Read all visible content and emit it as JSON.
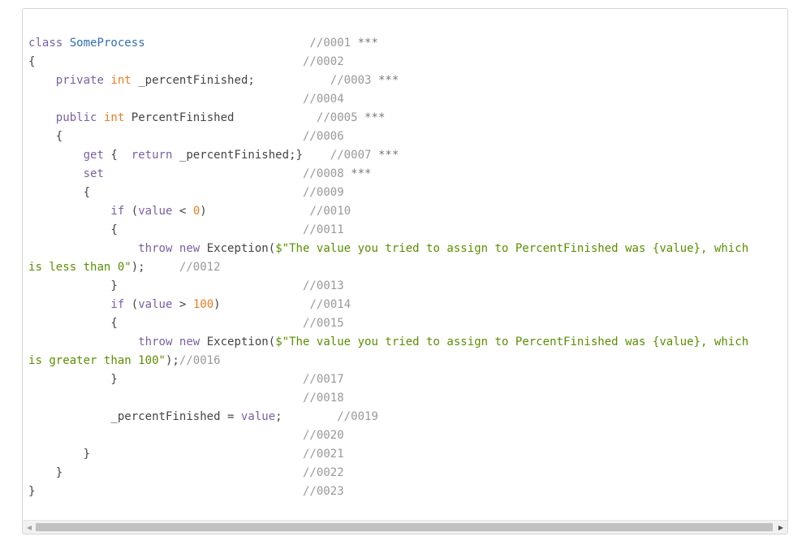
{
  "code": {
    "class_kw": "class",
    "class_name": "SomeProcess",
    "open_brace": "{",
    "close_brace": "}",
    "private_kw": "private",
    "public_kw": "public",
    "int_kw": "int",
    "field_decl": " _percentFinished;",
    "prop_name": " PercentFinished",
    "get_kw": "get",
    "get_body_open": " {  ",
    "return_kw": "return",
    "get_body_rest": " _percentFinished;}",
    "set_kw": "set",
    "if_kw": "if",
    "cond_lt_open": " (",
    "value_word": "value",
    "lt_op": " < ",
    "zero": "0",
    "gt_op": " > ",
    "hundred": "100",
    "close_paren": ")",
    "throw_kw": "throw",
    "new_kw": "new",
    "exception": " Exception(",
    "str_lt_part1": "$\"The value you tried to assign to PercentFinished was {value}, which",
    "str_lt_part2": "is less than 0\"",
    "str_gt_part2": "is greater than 100\"",
    "stmt_end": ");",
    "assign_lhs": "_percentFinished = ",
    "semicolon": ";",
    "comments": [
      "//0001",
      "//0002",
      "//0003",
      "//0004",
      "//0005",
      "//0006",
      "//0007",
      "//0008",
      "//0009",
      "//0010",
      "//0011",
      "//0012",
      "//0013",
      "//0014",
      "//0015",
      "//0016",
      "//0017",
      "//0018",
      "//0019",
      "//0020",
      "//0021",
      "//0022",
      "//0023"
    ],
    "marker": "***"
  },
  "scrollbar": {
    "left_arrow": "◀",
    "right_arrow": "▶"
  }
}
